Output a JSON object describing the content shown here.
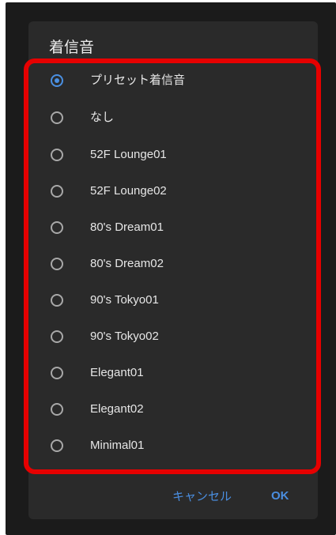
{
  "dialog": {
    "title": "着信音",
    "options": [
      {
        "label": "プリセット着信音",
        "selected": true
      },
      {
        "label": "なし",
        "selected": false
      },
      {
        "label": "52F Lounge01",
        "selected": false
      },
      {
        "label": "52F Lounge02",
        "selected": false
      },
      {
        "label": "80's Dream01",
        "selected": false
      },
      {
        "label": "80's Dream02",
        "selected": false
      },
      {
        "label": "90's Tokyo01",
        "selected": false
      },
      {
        "label": "90's Tokyo02",
        "selected": false
      },
      {
        "label": "Elegant01",
        "selected": false
      },
      {
        "label": "Elegant02",
        "selected": false
      },
      {
        "label": "Minimal01",
        "selected": false
      }
    ],
    "cancel_label": "キャンセル",
    "ok_label": "OK"
  },
  "colors": {
    "accent": "#4a90e2",
    "highlight": "#e60000",
    "dialog_bg": "#2a2a2a",
    "screen_bg": "#1b1b1b"
  }
}
